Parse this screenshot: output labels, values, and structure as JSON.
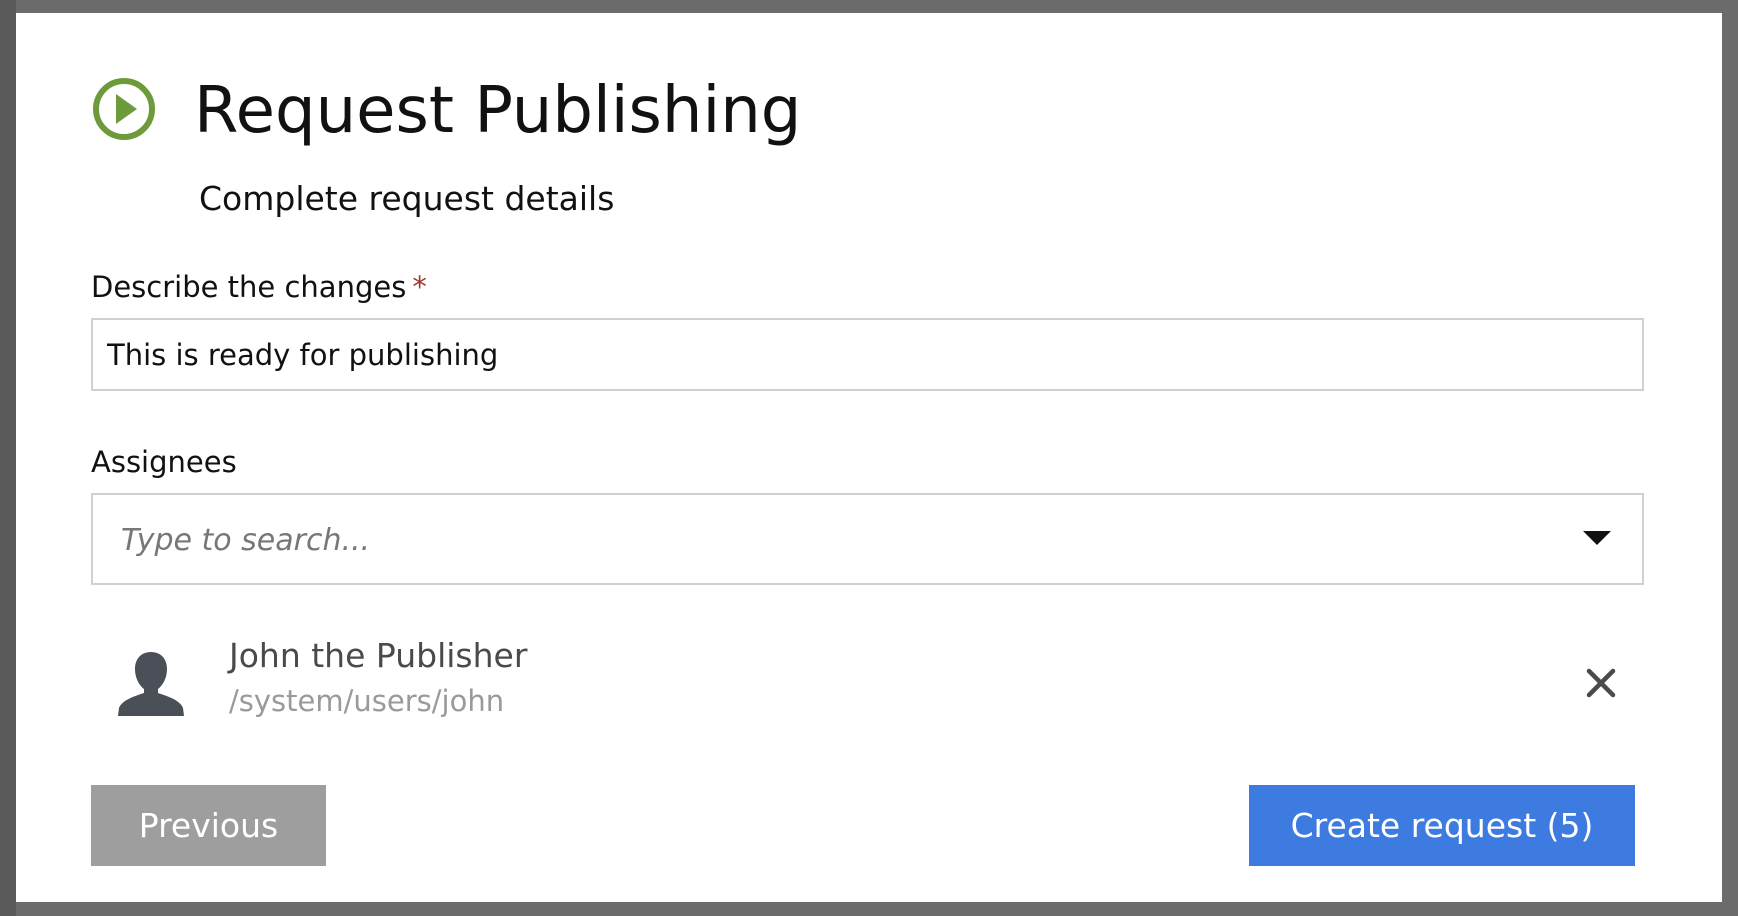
{
  "dialog": {
    "title": "Request Publishing",
    "subtitle": "Complete request details",
    "icon": "play-circle-icon",
    "accent_color": "#6d9a3a"
  },
  "form": {
    "changes_label": "Describe the changes",
    "required_marker": "*",
    "changes_value": "This is ready for publishing",
    "assignees_label": "Assignees",
    "assignees_placeholder": "Type to search..."
  },
  "assignees": [
    {
      "name": "John the Publisher",
      "path": "/system/users/john",
      "icon": "user-avatar-icon"
    }
  ],
  "buttons": {
    "previous_label": "Previous",
    "create_label": "Create request (5)",
    "create_color": "#3d7be0",
    "previous_color": "#9e9e9e"
  }
}
